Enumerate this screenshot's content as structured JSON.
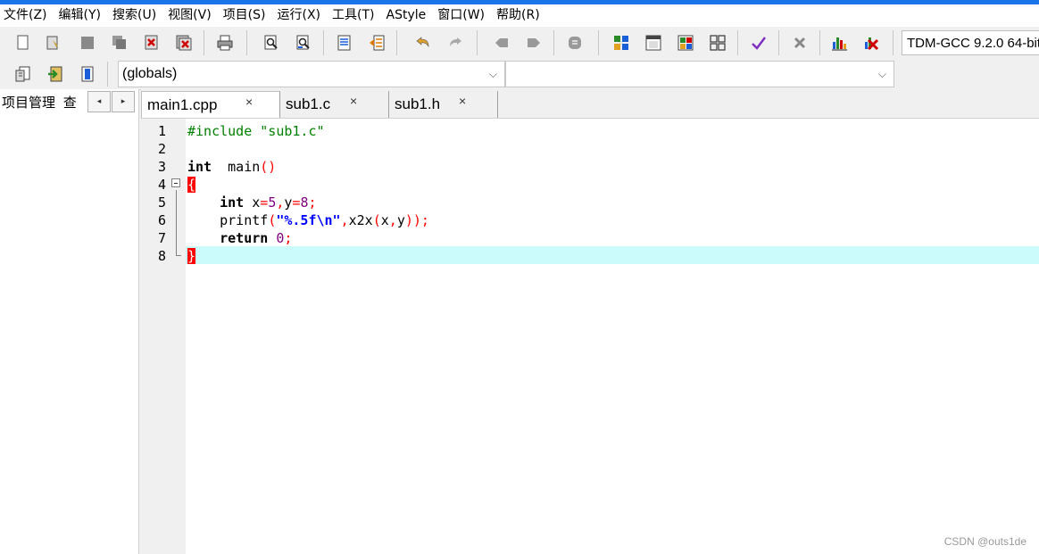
{
  "menu": [
    "文件(Z)",
    "编辑(Y)",
    "搜索(U)",
    "视图(V)",
    "项目(S)",
    "运行(X)",
    "工具(T)",
    "AStyle",
    "窗口(W)",
    "帮助(R)"
  ],
  "compiler": "TDM-GCC 9.2.0 64-bit",
  "scope_combo": "(globals)",
  "symbol_combo": "",
  "left_panel": {
    "tab_label": "项目管理",
    "tab2_label": "查"
  },
  "tabs": [
    {
      "label": "main1.cpp"
    },
    {
      "label": "sub1.c"
    },
    {
      "label": "sub1.h"
    }
  ],
  "line_numbers": [
    "1",
    "2",
    "3",
    "4",
    "5",
    "6",
    "7",
    "8"
  ],
  "code": {
    "l1_pre": "#include \"sub1.c\"",
    "l3_kw": "int",
    "l3_name": "  main",
    "l3_par": "()",
    "l4_brace": "{",
    "l5_kw": "int",
    "l5_a": " x",
    "l5_eq1": "=",
    "l5_n1": "5",
    "l5_c": ",",
    "l5_y": "y",
    "l5_eq2": "=",
    "l5_n2": "8",
    "l5_semi": ";",
    "l6_fn": "printf",
    "l6_p1": "(",
    "l6_str": "\"%.5f\\n\"",
    "l6_c1": ",",
    "l6_call": "x2x",
    "l6_p2": "(",
    "l6_x": "x",
    "l6_c2": ",",
    "l6_y": "y",
    "l6_end": "));",
    "l7_kw": "return",
    "l7_num": "0",
    "l7_semi": ";",
    "l8_brace": "}"
  },
  "watermark": "CSDN @outs1de"
}
